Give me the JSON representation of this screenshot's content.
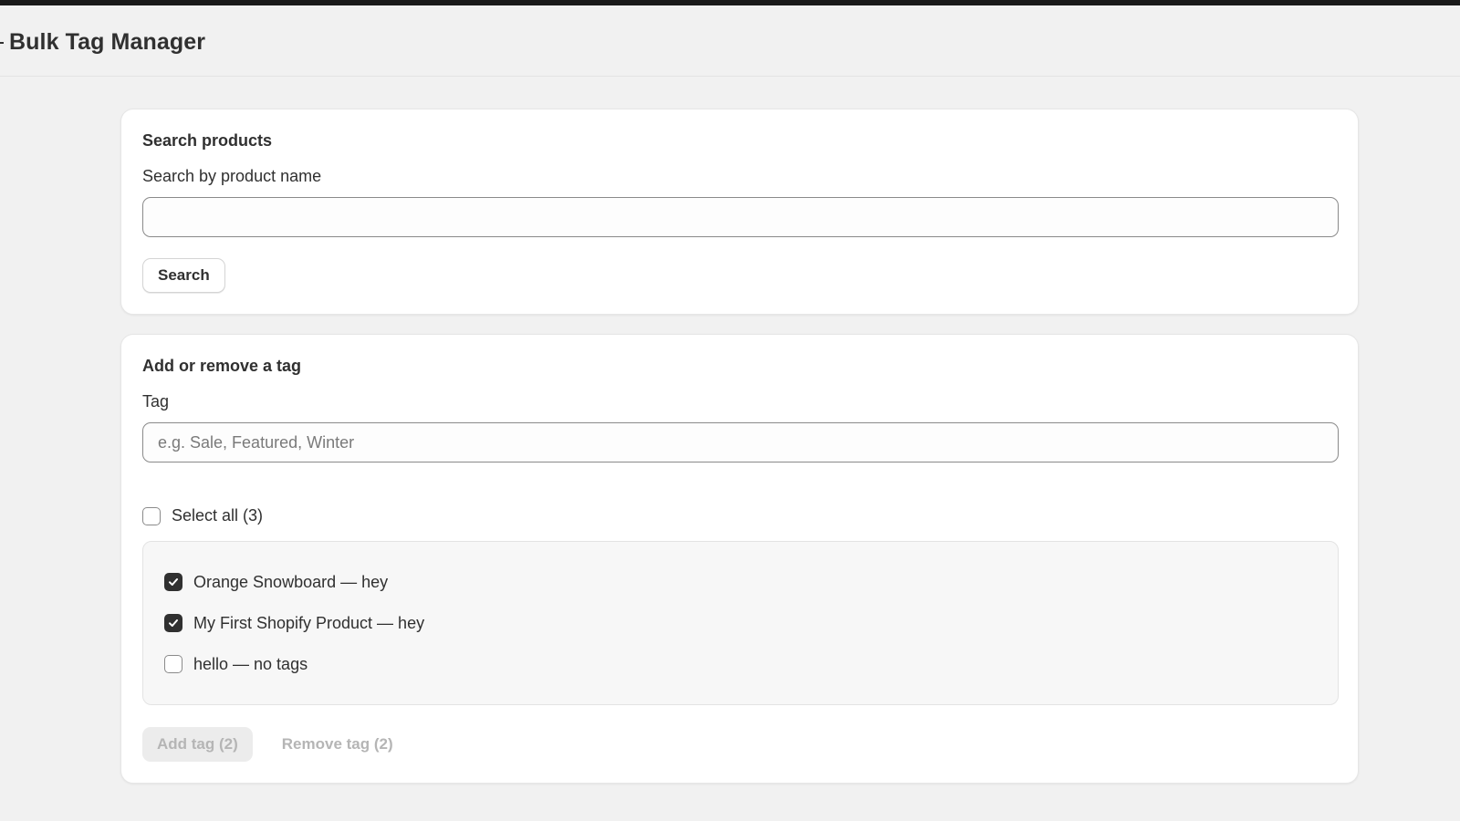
{
  "header": {
    "title": "Bulk Tag Manager"
  },
  "search_card": {
    "title": "Search products",
    "field_label": "Search by product name",
    "input_value": "",
    "input_placeholder": "",
    "search_button": "Search"
  },
  "tag_card": {
    "title": "Add or remove a tag",
    "field_label": "Tag",
    "input_value": "",
    "input_placeholder": "e.g. Sale, Featured, Winter",
    "select_all_label": "Select all (3)",
    "select_all_checked": false,
    "products": [
      {
        "label": "Orange Snowboard — hey",
        "checked": true
      },
      {
        "label": "My First Shopify Product — hey",
        "checked": true
      },
      {
        "label": "hello — no tags",
        "checked": false
      }
    ],
    "add_button": "Add tag (2)",
    "remove_button": "Remove tag (2)"
  },
  "icons": {
    "checkbox_check": "checkmark-icon"
  },
  "colors": {
    "page_background": "#f1f1f1",
    "card_background": "#ffffff",
    "checkbox_checked": "#303030",
    "disabled_text": "#b5b5b5"
  }
}
